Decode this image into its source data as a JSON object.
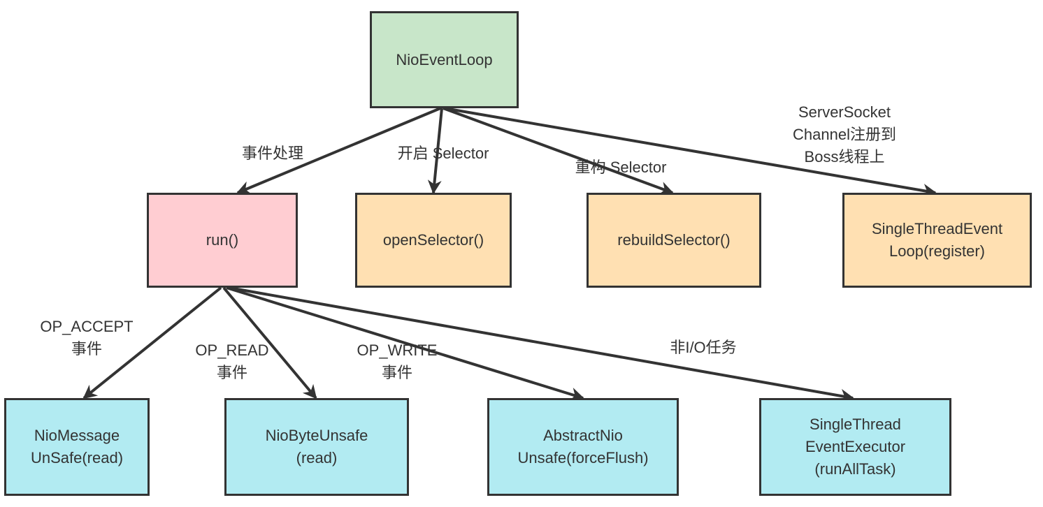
{
  "colors": {
    "stroke": "#333333",
    "root_fill": "#c8e6c9",
    "run_fill": "#ffcdd2",
    "selector_fill": "#ffe0b2",
    "unsafe_fill": "#b2ebf2",
    "text": "#333333"
  },
  "nodes": {
    "nioeventloop": {
      "label": "NioEventLoop",
      "fill": "#c8e6c9"
    },
    "run": {
      "label": "run()",
      "fill": "#ffcdd2"
    },
    "openselector": {
      "label": "openSelector()",
      "fill": "#ffe0b2"
    },
    "rebuildselector": {
      "label": "rebuildSelector()",
      "fill": "#ffe0b2"
    },
    "register": {
      "label": "SingleThreadEvent\nLoop(register)",
      "fill": "#ffe0b2"
    },
    "niomessageunsafe": {
      "label": "NioMessage\nUnSafe(read)",
      "fill": "#b2ebf2"
    },
    "niobyteunsafe": {
      "label": "NioByteUnsafe\n(read)",
      "fill": "#b2ebf2"
    },
    "abstractniounsafe": {
      "label": "AbstractNio\nUnsafe(forceFlush)",
      "fill": "#b2ebf2"
    },
    "runalltask": {
      "label": "SingleThread\nEventExecutor\n(runAllTask)",
      "fill": "#b2ebf2"
    }
  },
  "edges": [
    {
      "from": "nioeventloop",
      "to": "run",
      "label": "事件处理"
    },
    {
      "from": "nioeventloop",
      "to": "openselector",
      "label": "开启 Selector"
    },
    {
      "from": "nioeventloop",
      "to": "rebuildselector",
      "label": "重构 Selector"
    },
    {
      "from": "nioeventloop",
      "to": "register",
      "label": "ServerSocket\nChannel注册到\nBoss线程上"
    },
    {
      "from": "run",
      "to": "niomessageunsafe",
      "label": "OP_ACCEPT\n事件"
    },
    {
      "from": "run",
      "to": "niobyteunsafe",
      "label": "OP_READ\n事件"
    },
    {
      "from": "run",
      "to": "abstractniounsafe",
      "label": "OP_WRITE\n事件"
    },
    {
      "from": "run",
      "to": "runalltask",
      "label": "非I/O任务"
    }
  ]
}
